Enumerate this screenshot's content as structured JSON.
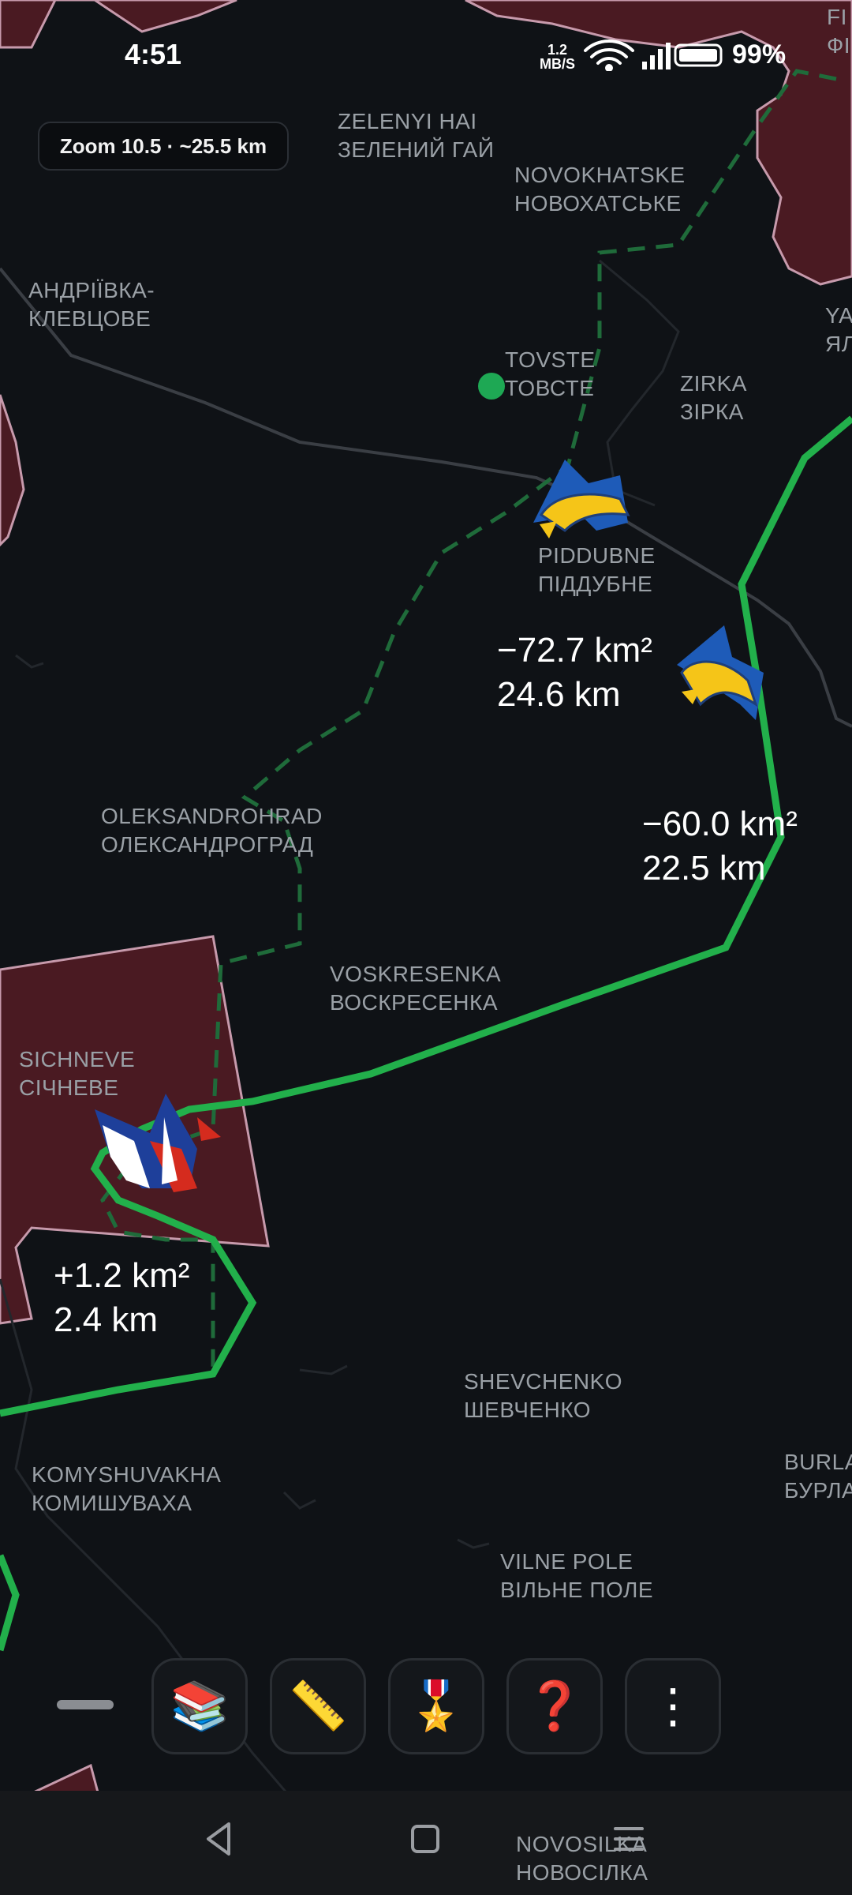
{
  "status_bar": {
    "time": "4:51",
    "net_speed_value": "1.2",
    "net_speed_unit": "MB/S",
    "battery_percent": "99%",
    "icons": [
      "wifi-icon",
      "signal-icon",
      "battery-icon"
    ]
  },
  "map": {
    "zoom_label": "Zoom 10.5 · ~25.5 km",
    "places": [
      {
        "name": "zelenyi-hai",
        "latin": "ZELENYI HAI",
        "cyrillic": "ЗЕЛЕНИЙ ГАЙ"
      },
      {
        "name": "novokhatske",
        "latin": "NOVOKHATSKE",
        "cyrillic": "НОВОХАТСЬКЕ"
      },
      {
        "name": "andriivka",
        "latin": "АНДРІЇВКА-",
        "cyrillic": "КЛЕВЦОВЕ"
      },
      {
        "name": "tovste",
        "latin": "TOVSTE",
        "cyrillic": "ТОВСТЕ"
      },
      {
        "name": "zirka",
        "latin": "ZIRKA",
        "cyrillic": "ЗІРКА"
      },
      {
        "name": "piddubne",
        "latin": "PIDDUBNE",
        "cyrillic": "ПІДДУБНЕ"
      },
      {
        "name": "oleksandrohrad",
        "latin": "OLEKSANDROHRAD",
        "cyrillic": "ОЛЕКСАНДРОГРАД"
      },
      {
        "name": "voskresenka",
        "latin": "VOSKRESENKA",
        "cyrillic": "ВОСКРЕСЕНКА"
      },
      {
        "name": "sichneve",
        "latin": "SICHNEVE",
        "cyrillic": "СІЧНЕВЕ"
      },
      {
        "name": "shevchenko",
        "latin": "SHEVCHENKO",
        "cyrillic": "ШЕВЧЕНКО"
      },
      {
        "name": "komyshuvakha",
        "latin": "KOMYSHUVAKHA",
        "cyrillic": "КОМИШУВАХА"
      },
      {
        "name": "vilne-pole",
        "latin": "VILNE POLE",
        "cyrillic": "ВІЛЬНЕ ПОЛЕ"
      },
      {
        "name": "burla",
        "latin": "BURLA",
        "cyrillic": "БУРЛА"
      },
      {
        "name": "ya",
        "latin": "YA",
        "cyrillic": "ЯЛ"
      },
      {
        "name": "fi",
        "latin": "FI",
        "cyrillic": "ФІ"
      },
      {
        "name": "novosilka",
        "latin": "NOVOSILKA",
        "cyrillic": "НОВОСІЛКА"
      }
    ],
    "stats": [
      {
        "name": "piddubne-stat",
        "area": "−72.7 km²",
        "distance": "24.6 km"
      },
      {
        "name": "east-stat",
        "area": "−60.0 km²",
        "distance": "22.5 km"
      },
      {
        "name": "sichneve-stat",
        "area": "+1.2 km²",
        "distance": "2.4 km"
      }
    ],
    "colors": {
      "background": "#0f1216",
      "occupied_fill": "#4a1a22",
      "occupied_border": "#c79aac",
      "front_line": "#22b04b",
      "dashed_line": "#1f6b3a",
      "roads": "#3a3e44",
      "ua_blue": "#1e5bb8",
      "ua_yellow": "#f5c518",
      "ru_red": "#d52b1e"
    }
  },
  "toolbar": {
    "buttons": [
      {
        "name": "layers-button",
        "icon": "books-icon",
        "glyph": "📚"
      },
      {
        "name": "ruler-button",
        "icon": "ruler-icon",
        "glyph": "📏"
      },
      {
        "name": "medal-button",
        "icon": "medal-icon",
        "glyph": "🎖️"
      },
      {
        "name": "help-button",
        "icon": "question-icon",
        "glyph": "❓"
      },
      {
        "name": "more-button",
        "icon": "more-vertical-icon",
        "glyph": "⋮"
      }
    ]
  },
  "nav_bar": {
    "buttons": [
      "back-icon",
      "home-icon",
      "menu-icon"
    ]
  }
}
